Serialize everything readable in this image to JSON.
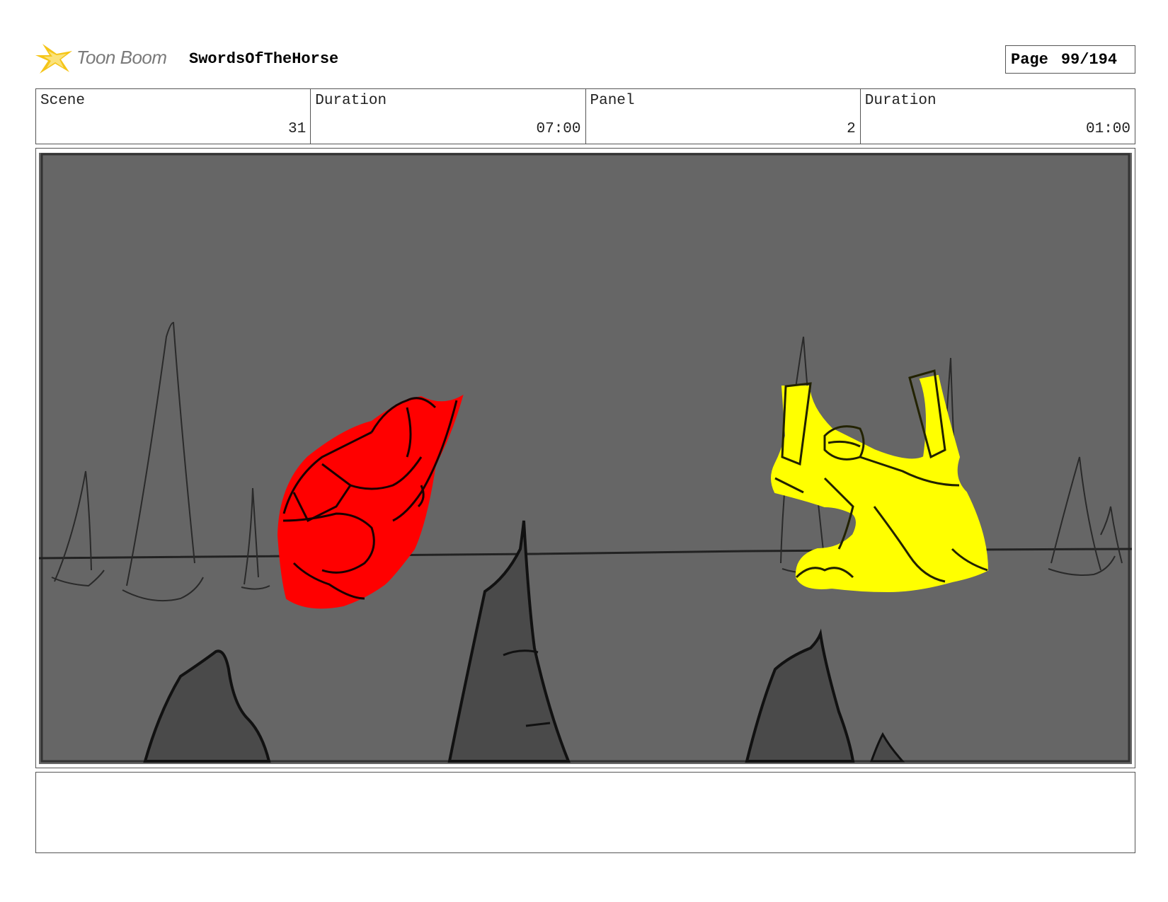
{
  "header": {
    "logo_text": "Toon Boom",
    "project_title": "SwordsOfTheHorse",
    "page_label": "Page",
    "page_number": "99/194"
  },
  "info": {
    "scene_label": "Scene",
    "scene_value": "31",
    "scene_duration_label": "Duration",
    "scene_duration_value": "07:00",
    "panel_label": "Panel",
    "panel_value": "2",
    "panel_duration_label": "Duration",
    "panel_duration_value": "01:00"
  },
  "colors": {
    "panel_background": "#666666",
    "red_character": "#ff0000",
    "yellow_character": "#ffff00",
    "rock": "#4a4a4a",
    "logo_accent": "#f5c518"
  },
  "notes": ""
}
